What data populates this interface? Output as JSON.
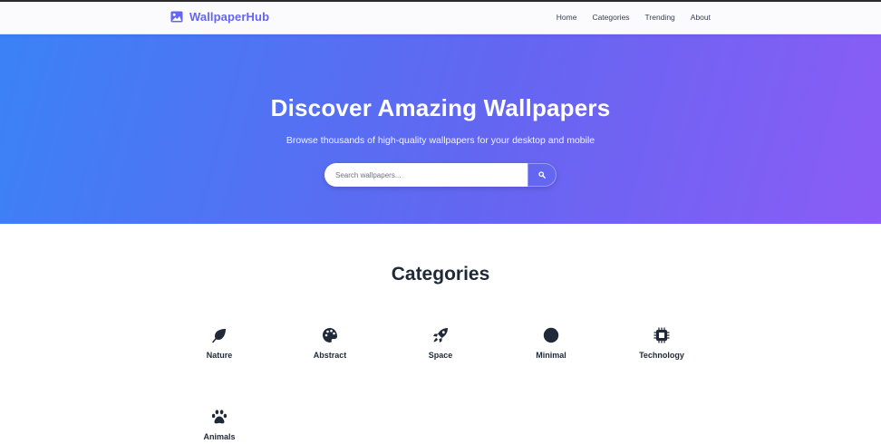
{
  "brand": {
    "name": "WallpaperHub",
    "icon": "image-icon",
    "color": "#6366f1"
  },
  "nav": [
    {
      "label": "Home"
    },
    {
      "label": "Categories"
    },
    {
      "label": "Trending"
    },
    {
      "label": "About"
    }
  ],
  "hero": {
    "title": "Discover Amazing Wallpapers",
    "subtitle": "Browse thousands of high-quality wallpapers for your desktop and mobile",
    "search_placeholder": "Search wallpapers...",
    "search_icon": "search-icon",
    "gradient": [
      "#3b82f6",
      "#6366f1",
      "#8b5cf6"
    ]
  },
  "categories": {
    "title": "Categories",
    "items": [
      {
        "label": "Nature",
        "icon": "leaf-icon"
      },
      {
        "label": "Abstract",
        "icon": "palette-icon"
      },
      {
        "label": "Space",
        "icon": "rocket-icon"
      },
      {
        "label": "Minimal",
        "icon": "circle-icon"
      },
      {
        "label": "Technology",
        "icon": "microchip-icon"
      },
      {
        "label": "Animals",
        "icon": "paw-icon"
      }
    ]
  }
}
